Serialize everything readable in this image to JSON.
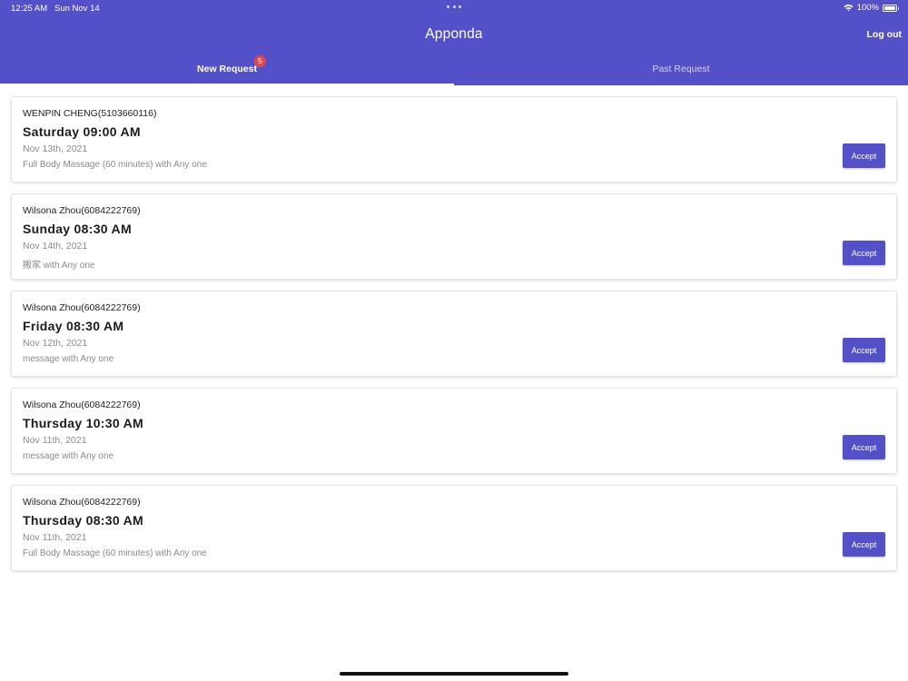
{
  "status_bar": {
    "time": "12:25 AM",
    "date": "Sun Nov 14",
    "battery": "100%",
    "battery_level": 1.0
  },
  "header": {
    "title": "Apponda",
    "logout_label": "Log out"
  },
  "tabs": [
    {
      "label": "New Request",
      "badge": "5",
      "active": true
    },
    {
      "label": "Past Request",
      "active": false
    }
  ],
  "colors": {
    "primary": "#5450c8",
    "badge": "#e04848"
  },
  "requests": [
    {
      "name": "WENPIN CHENG(5103660116)",
      "time": "Saturday 09:00 AM",
      "date": "Nov 13th, 2021",
      "service": "Full Body Massage (60 minutes) with Any one",
      "action": "Accept"
    },
    {
      "name": "Wilsona Zhou(6084222769)",
      "time": "Sunday 08:30 AM",
      "date": "Nov 14th, 2021",
      "service": "搬家 with Any one",
      "action": "Accept"
    },
    {
      "name": "Wilsona Zhou(6084222769)",
      "time": "Friday 08:30 AM",
      "date": "Nov 12th, 2021",
      "service": "message with Any one",
      "action": "Accept"
    },
    {
      "name": "Wilsona Zhou(6084222769)",
      "time": "Thursday 10:30 AM",
      "date": "Nov 11th, 2021",
      "service": "message with Any one",
      "action": "Accept"
    },
    {
      "name": "Wilsona Zhou(6084222769)",
      "time": "Thursday 08:30 AM",
      "date": "Nov 11th, 2021",
      "service": "Full Body Massage (60 minutes) with Any one",
      "action": "Accept"
    }
  ]
}
